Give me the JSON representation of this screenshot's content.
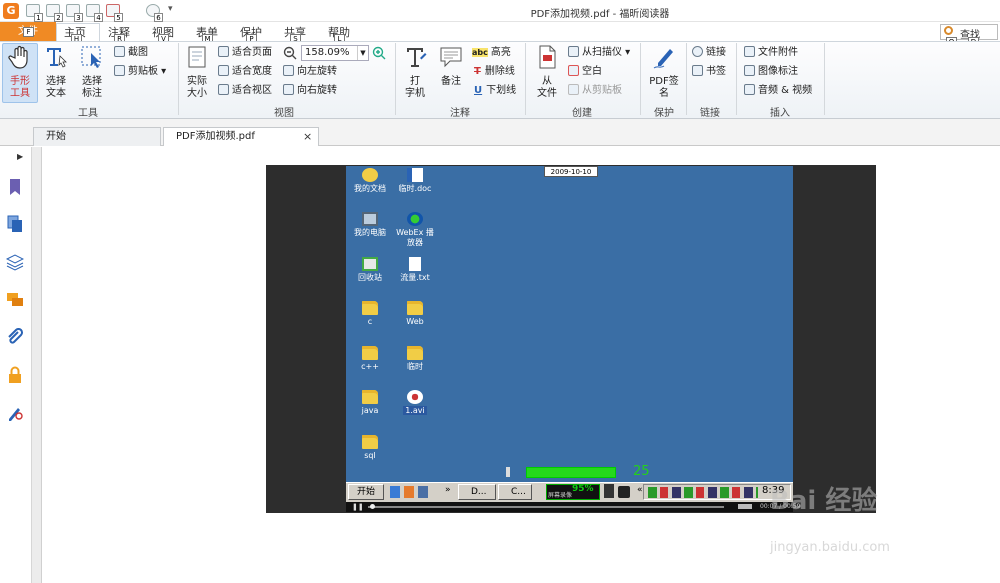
{
  "app": {
    "logo": "G",
    "title": "PDF添加视频.pdf - 福昕阅读器",
    "more": "▾"
  },
  "quick_access": [
    {
      "name": "new-icon",
      "key": "1"
    },
    {
      "name": "save-icon",
      "key": "2"
    },
    {
      "name": "print-icon",
      "key": "3"
    },
    {
      "name": "email-icon",
      "key": "4"
    },
    {
      "name": "undo-icon",
      "key": "5"
    },
    {
      "name": "redo-icon",
      "key": "6"
    }
  ],
  "search": {
    "label": "查找",
    "keys": [
      "Q",
      "D"
    ]
  },
  "menu_tabs": [
    {
      "label": "文件",
      "key": "F"
    },
    {
      "label": "主页",
      "key": "H"
    },
    {
      "label": "注释",
      "key": "R"
    },
    {
      "label": "视图",
      "key": "V"
    },
    {
      "label": "表单",
      "key": "M"
    },
    {
      "label": "保护",
      "key": "P"
    },
    {
      "label": "共享",
      "key": "S"
    },
    {
      "label": "帮助",
      "key": "L"
    }
  ],
  "ribbon": {
    "tools": {
      "group": "工具",
      "hand": "手形\n工具",
      "select_text": "选择\n文本",
      "select_annot": "选择\n标注",
      "screenshot": "截图",
      "clipboard": "剪贴板"
    },
    "view": {
      "group": "视图",
      "actual_size": "实际\n大小",
      "fit_page": "适合页面",
      "fit_width": "适合宽度",
      "fit_visible": "适合视区",
      "zoom_value": "158.09%",
      "rotate_left": "向左旋转",
      "rotate_right": "向右旋转"
    },
    "comment": {
      "group": "注释",
      "typewriter": "打\n字机",
      "note": "备注",
      "highlight": "高亮",
      "strikeout": "删除线",
      "underline": "下划线",
      "abc": "abc",
      "t": "T",
      "u": "U"
    },
    "create": {
      "group": "创建",
      "from_file": "从\n文件",
      "from_scanner": "从扫描仪",
      "blank": "空白",
      "from_clipboard": "从剪贴板"
    },
    "protect": {
      "group": "保护",
      "pdf_sign": "PDF签\n名"
    },
    "link": {
      "group": "链接",
      "link": "链接",
      "bookmark": "书签"
    },
    "insert": {
      "group": "插入",
      "file_attachment": "文件附件",
      "image_annotation": "图像标注",
      "audio_video": "音频 & 视频"
    }
  },
  "doc_tabs": [
    {
      "label": "开始"
    },
    {
      "label": "PDF添加视频.pdf"
    }
  ],
  "doc_tab_close": "×",
  "sidebar_arrow": "▶",
  "sidebar_icons": [
    "bookmark-icon",
    "pages-icon",
    "layers-icon",
    "comments-icon",
    "attachments-icon",
    "security-icon",
    "signature-icon"
  ],
  "video": {
    "date": "2009-10-10",
    "desktop_icons": [
      {
        "label": "我的文档",
        "kind": "docs"
      },
      {
        "label": "临时.doc",
        "kind": "doc"
      },
      {
        "label": "我的电脑",
        "kind": "pc"
      },
      {
        "label": "WebEx 播\n放器",
        "kind": "webex"
      },
      {
        "label": "回收站",
        "kind": "recycle"
      },
      {
        "label": "流量.txt",
        "kind": "txt"
      },
      {
        "label": "c",
        "kind": "folder"
      },
      {
        "label": "Web",
        "kind": "folder"
      },
      {
        "label": "c++",
        "kind": "folder"
      },
      {
        "label": "临时",
        "kind": "folder"
      },
      {
        "label": "java",
        "kind": "folder"
      },
      {
        "label": "1.avi",
        "kind": "avi"
      },
      {
        "label": "sql",
        "kind": "folder"
      }
    ],
    "volume_value": "25",
    "volume_level": 0.25,
    "taskbar": {
      "start": "开始",
      "d_button": "D...",
      "c_button": "C...",
      "rec_pct": "95%",
      "rec_label": "屏幕录像",
      "quick_more": "»",
      "tray_more": "«"
    },
    "clock": "8:39",
    "player_time": "00:07 / 00:59"
  },
  "watermark": {
    "logo": "Bai 经验",
    "url": "jingyan.baidu.com"
  }
}
